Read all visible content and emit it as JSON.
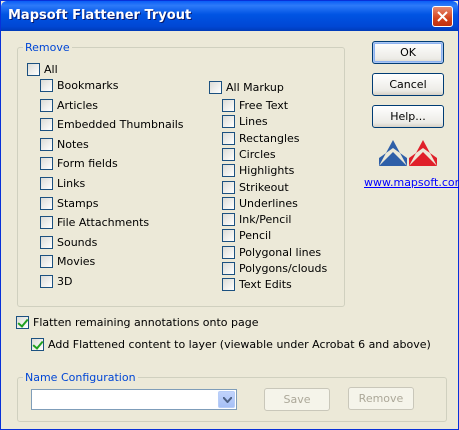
{
  "window": {
    "title": "Mapsoft Flattener Tryout"
  },
  "remove": {
    "legend": "Remove",
    "all_label": "All",
    "left_items": [
      "Bookmarks",
      "Articles",
      "Embedded Thumbnails",
      "Notes",
      "Form fields",
      "Links",
      "Stamps",
      "File Attachments",
      "Sounds",
      "Movies",
      "3D"
    ],
    "all_markup_label": "All Markup",
    "right_items": [
      "Free Text",
      "Lines",
      "Rectangles",
      "Circles",
      "Highlights",
      "Strikeout",
      "Underlines",
      "Ink/Pencil",
      "Pencil",
      "Polygonal lines",
      "Polygons/clouds",
      "Text Edits"
    ]
  },
  "buttons": {
    "ok": "OK",
    "cancel": "Cancel",
    "help": "Help..."
  },
  "brand": {
    "link": "www.mapsoft.com"
  },
  "options": {
    "flatten_label": "Flatten remaining annotations onto page",
    "flatten_checked": true,
    "layer_label": "Add Flattened content to layer (viewable under Acrobat 6 and above)",
    "layer_checked": true
  },
  "name_config": {
    "legend": "Name Configuration",
    "value": "",
    "save_label": "Save",
    "remove_label": "Remove"
  },
  "colors": {
    "title_bar": "#0054e3",
    "logo_blue": "#2e5fa8",
    "logo_red": "#e0202a"
  }
}
